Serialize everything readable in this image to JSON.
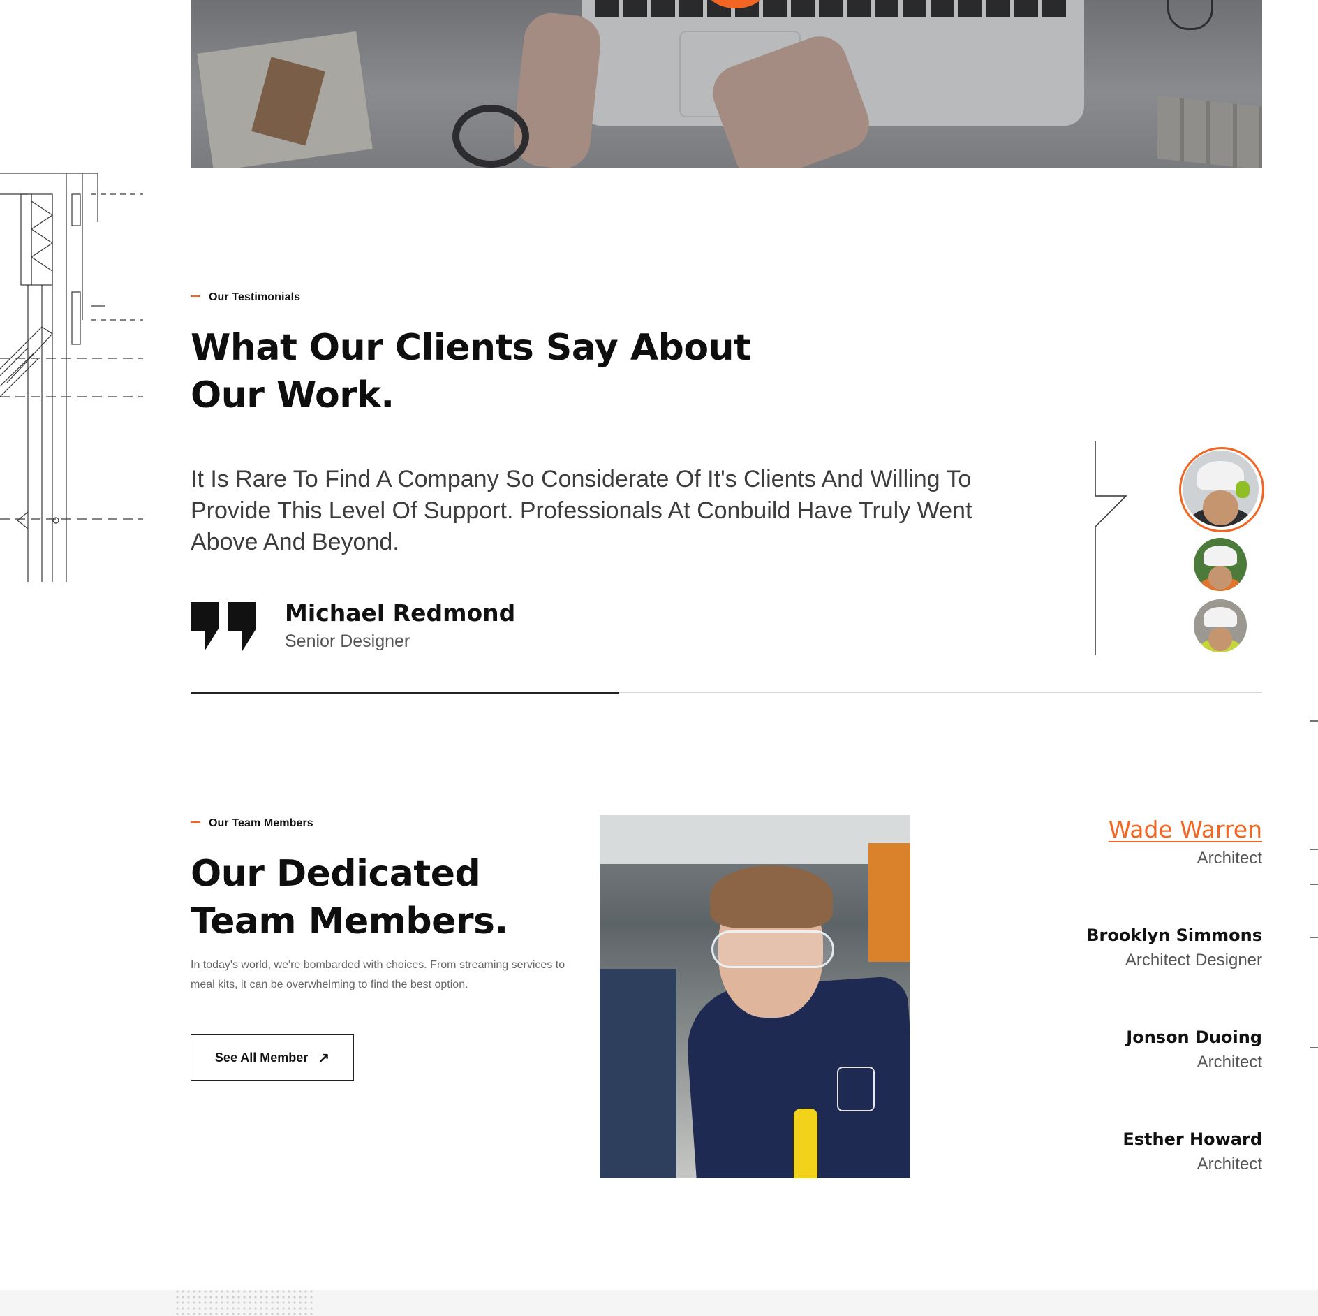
{
  "testimonials": {
    "eyebrow": "Our Testimonials",
    "heading_line1": "What Our Clients Say About",
    "heading_line2": "Our Work.",
    "quote": "It Is Rare To Find A Company So Considerate Of It's Clients And Willing To Provide This Level Of Support. Professionals At Conbuild Have Truly Went Above And Beyond.",
    "author_name": "Michael Redmond",
    "author_role": "Senior Designer",
    "progress": 0.4,
    "avatars": [
      {
        "icon": "avatar-worker-headset",
        "active": true
      },
      {
        "icon": "avatar-worker-helmet",
        "active": false
      },
      {
        "icon": "avatar-worker-hardhat",
        "active": false
      }
    ]
  },
  "team": {
    "eyebrow": "Our Team Members",
    "heading_line1": "Our Dedicated",
    "heading_line2": "Team Members.",
    "description": "In today's world, we're bombarded with choices. From streaming services to meal kits, it can be overwhelming to find the best option.",
    "button_label": "See All Member",
    "button_icon": "arrow-up-right-icon",
    "members": [
      {
        "name": "Wade Warren",
        "role": "Architect",
        "active": true
      },
      {
        "name": "Brooklyn Simmons",
        "role": "Architect Designer",
        "active": false
      },
      {
        "name": "Jonson Duoing",
        "role": "Architect",
        "active": false
      },
      {
        "name": "Esther Howard",
        "role": "Architect",
        "active": false
      }
    ]
  },
  "colors": {
    "accent": "#f26522",
    "heading": "#0e0e0e",
    "body_text": "#3d3d3d",
    "muted": "#555555"
  }
}
